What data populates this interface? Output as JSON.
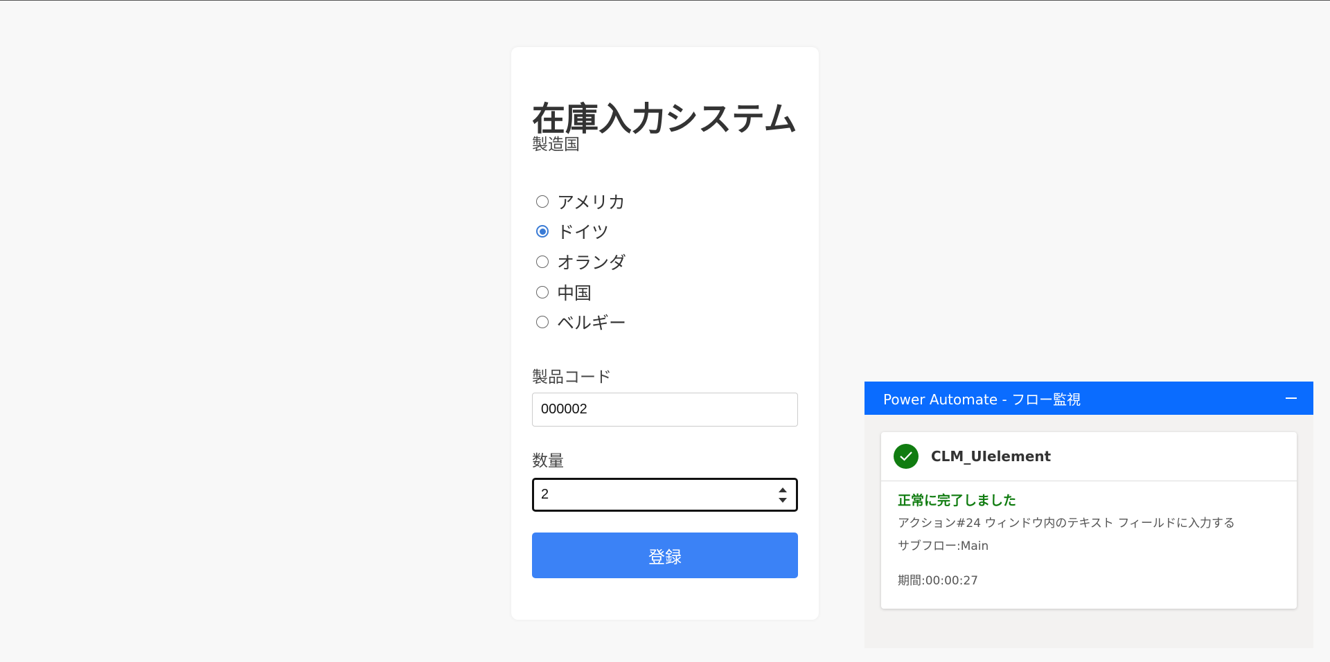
{
  "form": {
    "title": "在庫入力システム",
    "country_label": "製造国",
    "countries": [
      {
        "label": "アメリカ",
        "checked": false
      },
      {
        "label": "ドイツ",
        "checked": true
      },
      {
        "label": "オランダ",
        "checked": false
      },
      {
        "label": "中国",
        "checked": false
      },
      {
        "label": "ベルギー",
        "checked": false
      }
    ],
    "product_code_label": "製品コード",
    "product_code_value": "000002",
    "quantity_label": "数量",
    "quantity_value": "2",
    "submit_label": "登録"
  },
  "power_automate": {
    "header_title": "Power Automate - フロー監視",
    "flow_name": "CLM_UIelement",
    "status": "正常に完了しました",
    "action_text": "アクション#24 ウィンドウ内のテキスト フィールドに入力する",
    "subflow_text": "サブフロー:Main",
    "duration_text": "期間:00:00:27",
    "status_color": "#107c10",
    "header_color": "#0a6cff"
  }
}
